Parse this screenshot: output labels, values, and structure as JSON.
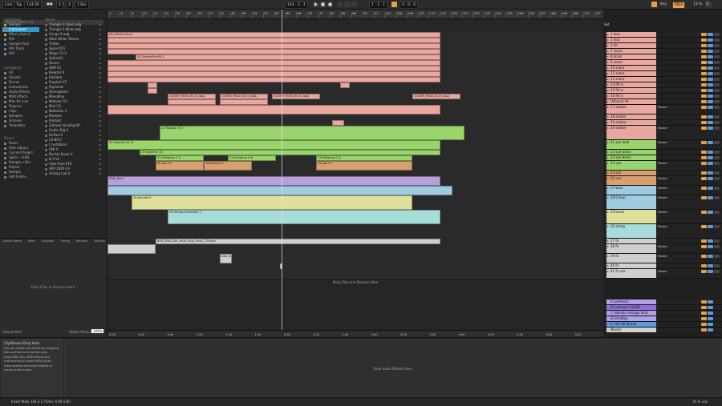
{
  "topbar": {
    "link": "Link",
    "tap": "Tap",
    "tempo": "124.00",
    "sig_num": "4",
    "sig_den": "4",
    "quant": "1 Bar",
    "position": "144 .  3 .  1",
    "loop_start": "1 .  1 .  1",
    "loop_len": "4 .  0 .  0",
    "key": "Key",
    "midi": "MIDI",
    "cpu": "13 %",
    "d_label": "D"
  },
  "browser": {
    "search_placeholder": "Search (Cmd + F)",
    "collections_header": "Collections",
    "collections": [
      {
        "label": "Sample",
        "color": "#e0a040"
      },
      {
        "label": "Instrument",
        "color": "#e06030",
        "selected": true
      },
      {
        "label": "Effect_Gum.E",
        "color": "#e0c040"
      },
      {
        "label": "FAV",
        "color": "#40b040"
      },
      {
        "label": "Sample Pack",
        "color": "#4090e0"
      },
      {
        "label": "FAV Track",
        "color": "#a060e0"
      },
      {
        "label": "FAV",
        "color": "#909090"
      }
    ],
    "categories_header": "Categories",
    "categories": [
      "All",
      "Sounds",
      "Drums",
      "Instruments",
      "Audio Effects",
      "MIDI Effects",
      "Max for Live",
      "Plug-Ins",
      "Clips",
      "Samples",
      "Grooves",
      "Templates"
    ],
    "places_header": "Places",
    "places": [
      "Packs",
      "User Library",
      "Current Project",
      "Splice - LUKE",
      "Sample <3A>",
      "Project",
      "Sample",
      "Add Folder..."
    ],
    "name_header": "Name",
    "names": [
      "Triangle S Open.adg",
      "Triangle S Mute.adg",
      "Congo S.adg",
      "Wide Wider Stereo",
      "Trillian",
      "Spire-VSTi",
      "Stage-73 V",
      "Sylenth1",
      "Serum",
      "SEM V2",
      "Reaktor 6",
      "Radiator",
      "Prophet V3",
      "Pigments",
      "Omnisphere",
      "MonoPoly",
      "Modular V3",
      "Mini V3",
      "Mellotron V",
      "Massive",
      "Kontakt",
      "iZotope VocalSynth",
      "Guitar Rig 6",
      "Farfisa V",
      "CS-80 V",
      "Crystallizer",
      "CMI V",
      "Buchla Easel V",
      "B-3 V2",
      "Auto-Tune EFX",
      "ARP 2600 V3",
      "Analog Lab 4"
    ],
    "groove_cols": [
      "Groove Name",
      "Base",
      "Quantize",
      "Timing",
      "Random",
      "Velocity"
    ],
    "groove_drop": "Drop Clips or Grooves Here",
    "groove_pool": "Groove Pool",
    "global_amount_label": "Global Amount",
    "global_amount": "100%"
  },
  "ruler": {
    "bars": [
      "1",
      "5",
      "9",
      "13",
      "17",
      "21",
      "25",
      "29",
      "33",
      "37",
      "41",
      "45",
      "49",
      "53",
      "57",
      "61",
      "65",
      "69",
      "73",
      "77",
      "81",
      "85",
      "89",
      "93",
      "97",
      "101",
      "105",
      "109",
      "113",
      "117",
      "121",
      "125",
      "129",
      "133",
      "137",
      "141",
      "145",
      "149",
      "153",
      "157",
      "161",
      "165",
      "169",
      "173",
      "177"
    ],
    "times": [
      "0:00",
      "0:20",
      "0:40",
      "1:00",
      "1:20",
      "1:40",
      "2:00",
      "2:20",
      "2:40",
      "3:00",
      "3:20",
      "3:40",
      "4:00",
      "4:20",
      "4:40",
      "5:00",
      "5:20"
    ]
  },
  "tracks": [
    {
      "name": "1 kick",
      "color": "#e8a8a0",
      "h": 6
    },
    {
      "name": "3 kick",
      "color": "#e8a8a0",
      "h": 6
    },
    {
      "name": "5 hh",
      "color": "#e8a8a0",
      "h": 6
    },
    {
      "name": "7 snare",
      "color": "#e8a8a0",
      "h": 6
    },
    {
      "name": "8 drum",
      "color": "#e8a8a0",
      "h": 6
    },
    {
      "name": "9 snare",
      "color": "#e8a8a0",
      "h": 6
    },
    {
      "name": "10 snare",
      "color": "#e8a8a0",
      "h": 6
    },
    {
      "name": "11 snare",
      "color": "#e8a8a0",
      "h": 6
    },
    {
      "name": "13 snare",
      "color": "#e8a8a0",
      "h": 6
    },
    {
      "name": "14 fill in",
      "color": "#e8a8a0",
      "h": 6
    },
    {
      "name": "15 fill in",
      "color": "#e8a8a0",
      "h": 6
    },
    {
      "name": "16 fill in",
      "color": "#e8a8a0",
      "h": 6
    },
    {
      "name": "Ukbeam hh",
      "color": "#e8a8a0",
      "h": 6
    },
    {
      "name": "17 shaker",
      "color": "#e8a8a0",
      "h": 11,
      "out": "Master"
    },
    {
      "name": "18 shaker",
      "color": "#e8a8a0",
      "h": 6
    },
    {
      "name": "19 shaker",
      "color": "#e8a8a0",
      "h": 6
    },
    {
      "name": "20 shaker",
      "color": "#e8a8a0",
      "h": 17,
      "out": "Master"
    },
    {
      "name": "21 syn lead",
      "color": "#9ad46c",
      "h": 11,
      "out": "Master"
    },
    {
      "name": "23 syn brass",
      "color": "#9ad46c",
      "h": 6
    },
    {
      "name": "22 syn brass",
      "color": "#9ad46c",
      "h": 6
    },
    {
      "name": "24 syn",
      "color": "#9ad46c",
      "h": 11,
      "out": "Master"
    },
    {
      "name": "24 syn",
      "color": "#d8a070",
      "h": 6
    },
    {
      "name": "26 vox",
      "color": "#d8a070",
      "h": 11,
      "out": "Master"
    },
    {
      "name": "27 bass",
      "color": "#9ecbe0",
      "h": 11,
      "out": "Master"
    },
    {
      "name": "28 Group",
      "color": "#9ecbe0",
      "h": 17,
      "out": "Master"
    },
    {
      "name": "29 brass",
      "color": "#dfe09c",
      "h": 17,
      "out": "Master"
    },
    {
      "name": "30 string",
      "color": "#a8dcd8",
      "h": 17,
      "out": "Master"
    },
    {
      "name": "27 fx",
      "color": "#cfcfcf",
      "h": 6
    },
    {
      "name": "38 fx",
      "color": "#cfcfcf",
      "h": 11,
      "out": "Master"
    },
    {
      "name": "39 fx",
      "color": "#cfcfcf",
      "h": 11,
      "out": "Master"
    },
    {
      "name": "40 fx",
      "color": "#cfcfcf",
      "h": 6
    },
    {
      "name": "41 fx vox",
      "color": "#cfcfcf",
      "h": 11,
      "out": "Master"
    }
  ],
  "clip_labels": {
    "drum_verse": "DA_DRUM_Verse",
    "sample_pre": "30 SamplePre-Kit 2",
    "oliver": "OLIVER_Hihat_drum_loop",
    "mod1": "21 Modular V3 3",
    "prophet": "22-Prophet V3 13",
    "sylenth": "23 Sylenth1 13",
    "mellotron": "23-Mellotron V 4",
    "mellotron2": "23-Mellotron V 6",
    "kontakt": "26-Kontakt 4",
    "vox": "26 vox 13",
    "bass": "Dirty Bass",
    "kontakt5": "26-Kontakt 5",
    "strings": "28-Strings Ensemble 1",
    "fx_sinclair": "BOB_SINCLAIR_vocal_loop_funky_120bpm",
    "fx_disco": "EML Disco Hit 2.8 [2020-02-20 10:29]",
    "wahwah": "wah_wah"
  },
  "drop_files": "Drop Files and Devices Here",
  "returns": [
    {
      "name": "A Lexfroom",
      "color": "#b0a0e8"
    },
    {
      "name": "B Lexfroom 1SASE",
      "color": "#9070d8"
    },
    {
      "name": "C Valhalla Vintage Verb",
      "color": "#b0a0e8"
    },
    {
      "name": "D EchoBoy",
      "color": "#b0a0e8"
    },
    {
      "name": "E CLA-76 Stereo",
      "color": "#5a9be0"
    },
    {
      "name": "Master",
      "color": "#cfcfcf"
    }
  ],
  "mixer_header": {
    "set": "Set",
    "sig": "1/4",
    "master_val": "0"
  },
  "device_panel": {
    "info_title": "Clip/Device Drop Area",
    "info_lines": [
      "You can create new tracks by dropping files and devices into this area.",
      "Drop MIDI Files, MIDI effects and instruments to create MIDI tracks.",
      "Drop samples and audio effects to create audio tracks."
    ],
    "drop_audio": "Drop Audio Effects Here"
  },
  "status": {
    "left": "Insert Mark 144.3.1 (Time: 4:40:130)",
    "right": "41 fx vox"
  }
}
